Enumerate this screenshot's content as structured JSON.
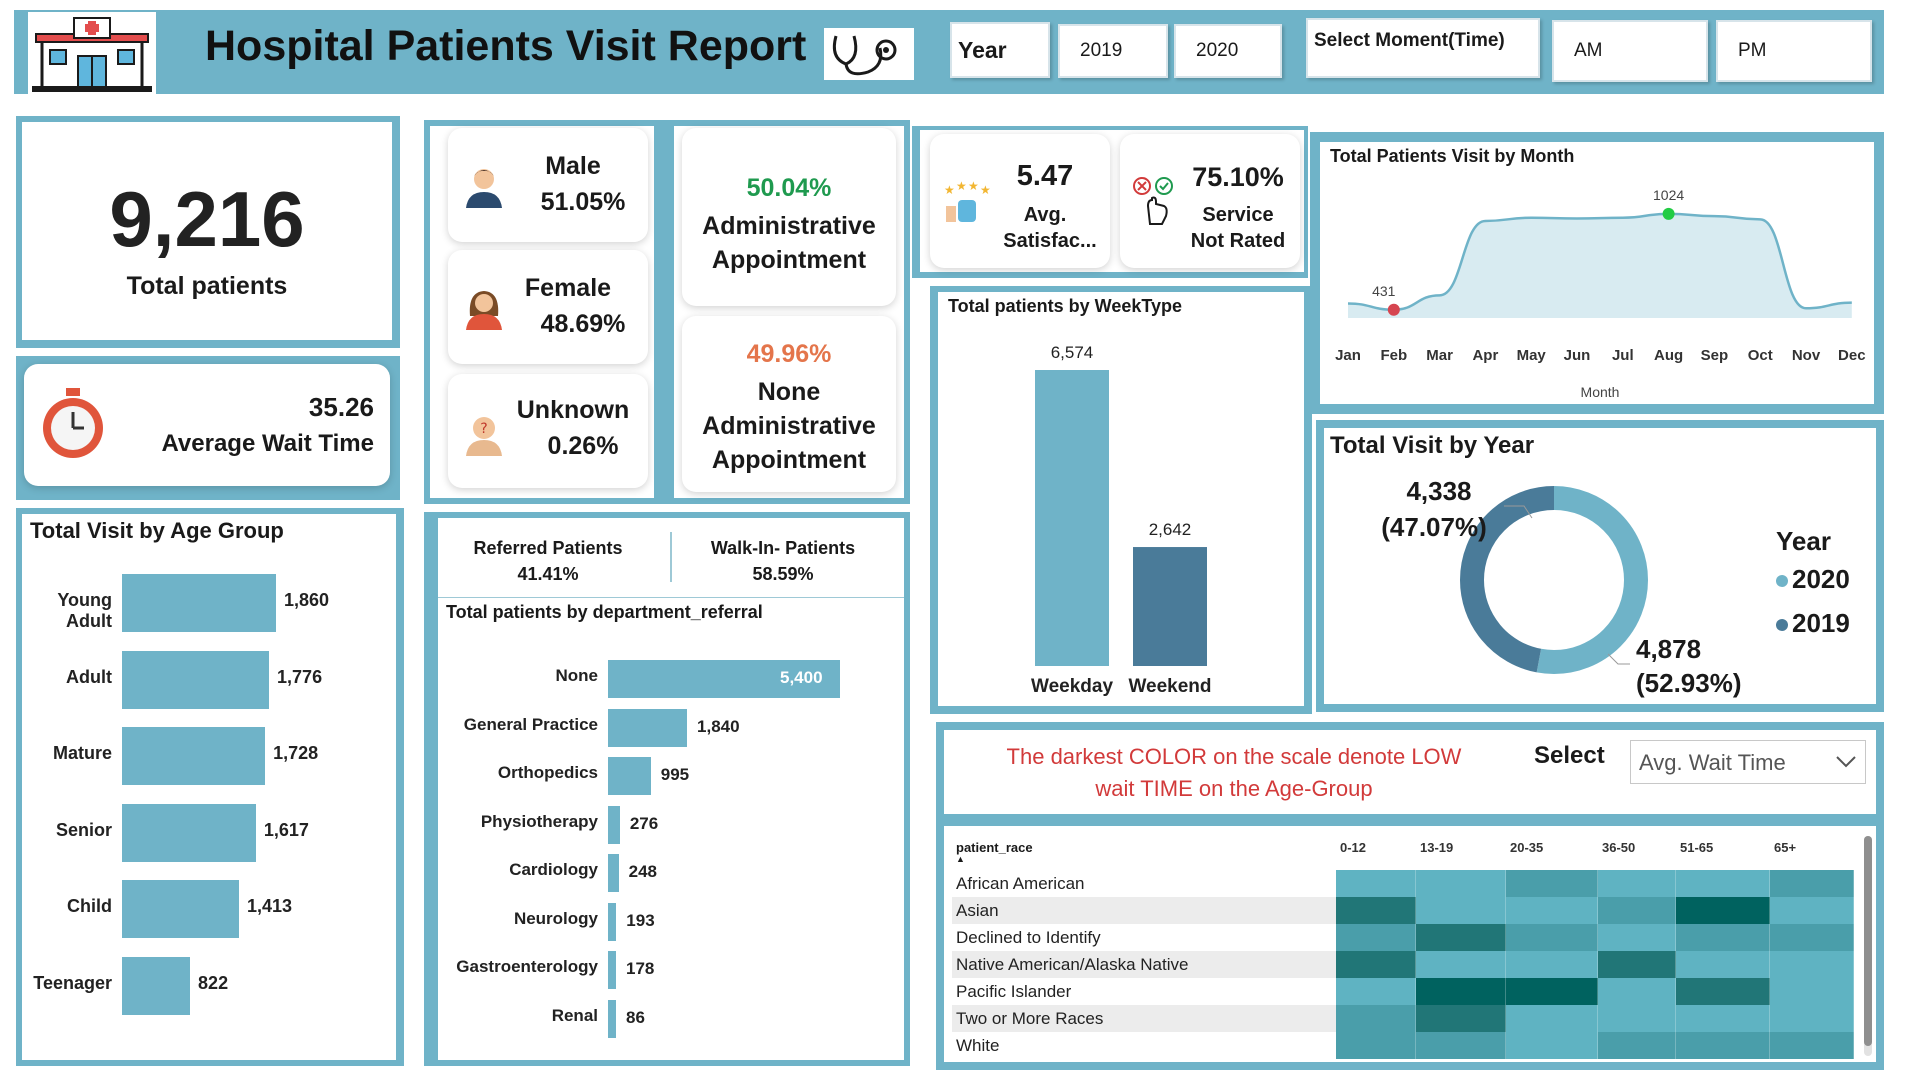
{
  "header": {
    "title": "Hospital Patients Visit Report",
    "year_label": "Year",
    "years": [
      "2019",
      "2020"
    ],
    "moment_label": "Select Moment(Time)",
    "moments": [
      "AM",
      "PM"
    ]
  },
  "kpis": {
    "total_patients_value": "9,216",
    "total_patients_label": "Total patients",
    "avg_wait_value": "35.26",
    "avg_wait_label": "Average Wait Time",
    "satisfaction_value": "5.47",
    "satisfaction_label_1": "Avg.",
    "satisfaction_label_2": "Satisfac...",
    "service_not_rated_value": "75.10%",
    "service_not_rated_label_1": "Service",
    "service_not_rated_label_2": "Not Rated"
  },
  "gender": [
    {
      "label": "Male",
      "value": "51.05%",
      "icon": "male-avatar-icon"
    },
    {
      "label": "Female",
      "value": "48.69%",
      "icon": "female-avatar-icon"
    },
    {
      "label": "Unknown",
      "value": "0.26%",
      "icon": "unknown-avatar-icon"
    }
  ],
  "appointments": {
    "admin_value": "50.04%",
    "admin_label_1": "Administrative",
    "admin_label_2": "Appointment",
    "none_value": "49.96%",
    "none_label_1": "None",
    "none_label_2": "Administrative",
    "none_label_3": "Appointment",
    "colors": {
      "admin": "#1f9a4f",
      "none": "#e4754b"
    }
  },
  "age_group": {
    "title": "Total Visit by Age Group",
    "chart_data": {
      "type": "bar",
      "orientation": "horizontal",
      "categories": [
        "Young Adult",
        "Adult",
        "Mature",
        "Senior",
        "Child",
        "Teenager"
      ],
      "values": [
        1860,
        1776,
        1728,
        1617,
        1413,
        822
      ],
      "labels": [
        "1,860",
        "1,776",
        "1,728",
        "1,617",
        "1,413",
        "822"
      ]
    }
  },
  "referral": {
    "referred_label": "Referred Patients",
    "referred_value": "41.41%",
    "walkin_label": "Walk-In- Patients",
    "walkin_value": "58.59%",
    "title": "Total patients by department_referral",
    "chart_data": {
      "type": "bar",
      "orientation": "horizontal",
      "categories": [
        "None",
        "General Practice",
        "Orthopedics",
        "Physiotherapy",
        "Cardiology",
        "Neurology",
        "Gastroenterology",
        "Renal"
      ],
      "values": [
        5400,
        1840,
        995,
        276,
        248,
        193,
        178,
        86
      ],
      "labels": [
        "5,400",
        "1,840",
        "995",
        "276",
        "248",
        "193",
        "178",
        "86"
      ]
    }
  },
  "weektype": {
    "title": "Total patients by WeekType",
    "chart_data": {
      "type": "bar",
      "categories": [
        "Weekday",
        "Weekend"
      ],
      "values": [
        6574,
        2642
      ],
      "labels": [
        "6,574",
        "2,642"
      ],
      "colors": [
        "#6fb3c8",
        "#4a7b99"
      ]
    }
  },
  "monthly": {
    "title": "Total Patients Visit by Month",
    "xlabel": "Month",
    "chart_data": {
      "type": "area",
      "categories": [
        "Jan",
        "Feb",
        "Mar",
        "Apr",
        "May",
        "Jun",
        "Jul",
        "Aug",
        "Sep",
        "Oct",
        "Nov",
        "Dec"
      ],
      "values": [
        470,
        431,
        520,
        980,
        1000,
        995,
        1000,
        1024,
        1010,
        990,
        440,
        475
      ],
      "min_label": "431",
      "max_label": "1024",
      "min_index": 1,
      "max_index": 7
    }
  },
  "yearly": {
    "title": "Total Visit by Year",
    "legend_title": "Year",
    "chart_data": {
      "type": "pie",
      "donut": true,
      "series": [
        {
          "name": "2020",
          "value": 4878,
          "label": "4,878",
          "pct": "(52.93%)",
          "color": "#6fb3c8"
        },
        {
          "name": "2019",
          "value": 4338,
          "label": "4,338",
          "pct": "(47.07%)",
          "color": "#4a7b99"
        }
      ]
    }
  },
  "note": {
    "line1": "The darkest COLOR on the scale denote LOW",
    "line2": "wait TIME on the Age-Group",
    "select_label": "Select",
    "select_value": "Avg. Wait Time",
    "color": "#d23a3a"
  },
  "heatmap": {
    "chart_data": {
      "type": "heatmap",
      "row_header": "patient_race",
      "columns": [
        "0-12",
        "13-19",
        "20-35",
        "36-50",
        "51-65",
        "65+"
      ],
      "rows": [
        "African American",
        "Asian",
        "Declined to Identify",
        "Native American/Alaska Native",
        "Pacific Islander",
        "Two or More Races",
        "White"
      ],
      "levels": [
        [
          3,
          3,
          2,
          3,
          3,
          2
        ],
        [
          1,
          3,
          3,
          2,
          0,
          3
        ],
        [
          2,
          1,
          2,
          3,
          2,
          2
        ],
        [
          1,
          3,
          3,
          1,
          3,
          3
        ],
        [
          3,
          0,
          0,
          3,
          1,
          3
        ],
        [
          2,
          1,
          3,
          3,
          3,
          3
        ],
        [
          2,
          2,
          3,
          2,
          2,
          2
        ]
      ],
      "scale_note": "darker = lower avg wait time"
    }
  }
}
